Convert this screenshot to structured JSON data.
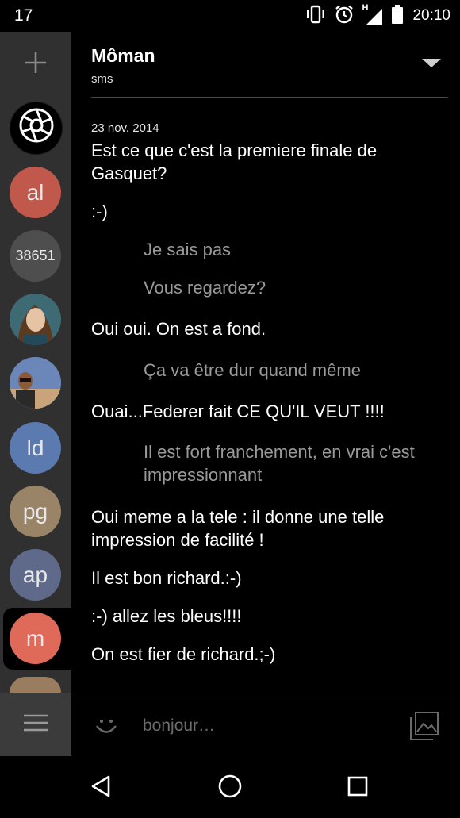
{
  "status_bar": {
    "notification_count": "17",
    "network_type": "H",
    "time": "20:10",
    "icons": [
      "vibrate-icon",
      "alarm-icon",
      "signal-icon",
      "battery-icon"
    ]
  },
  "sidebar": {
    "add_icon": "plus-icon",
    "contacts": [
      {
        "label": "",
        "type": "aperture-logo",
        "color": "#000000"
      },
      {
        "label": "al",
        "color": "#c0594b"
      },
      {
        "label": "38651",
        "color": "#4e4e4e"
      },
      {
        "label": "",
        "type": "photo",
        "color": "#2e4a56"
      },
      {
        "label": "",
        "type": "photo",
        "color": "#3b4e6a"
      },
      {
        "label": "ld",
        "color": "#5a7ab0"
      },
      {
        "label": "pg",
        "color": "#9a8468"
      },
      {
        "label": "ap",
        "color": "#5f6a8a"
      },
      {
        "label": "m",
        "color": "#e06a5a",
        "selected": true
      },
      {
        "label": "",
        "color": "#9a7c5e"
      }
    ],
    "menu_icon": "hamburger-icon"
  },
  "header": {
    "title": "Môman",
    "subtitle": "sms",
    "dropdown_icon": "dropdown-arrow-icon"
  },
  "conversation": {
    "date": "23 nov. 2014",
    "messages": [
      {
        "text": "Est ce que c'est la premiere finale de Gasquet?",
        "direction": "in"
      },
      {
        "text": ":-)",
        "direction": "in"
      },
      {
        "text": "Je sais pas",
        "direction": "out"
      },
      {
        "text": "Vous regardez?",
        "direction": "out"
      },
      {
        "text": "Oui oui. On est a fond.",
        "direction": "in"
      },
      {
        "text": "Ça va être dur quand même",
        "direction": "out"
      },
      {
        "text": "Ouai...Federer fait CE QU'IL VEUT !!!!",
        "direction": "in"
      },
      {
        "text": "Il est fort franchement, en vrai c'est impressionnant",
        "direction": "out"
      },
      {
        "text": "Oui meme a la tele : il donne une telle impression de facilité !",
        "direction": "in"
      },
      {
        "text": "Il est bon richard.:-)",
        "direction": "in"
      },
      {
        "text": ":-) allez les bleus!!!!",
        "direction": "in"
      },
      {
        "text": "On est fier de richard.;-)",
        "direction": "in"
      }
    ]
  },
  "compose": {
    "placeholder": "bonjour…",
    "value": "",
    "emoji_icon": "smiley-icon",
    "attach_icon": "gallery-icon"
  },
  "nav_bar": {
    "icons": [
      "back-triangle-icon",
      "home-circle-icon",
      "recents-square-icon"
    ]
  }
}
